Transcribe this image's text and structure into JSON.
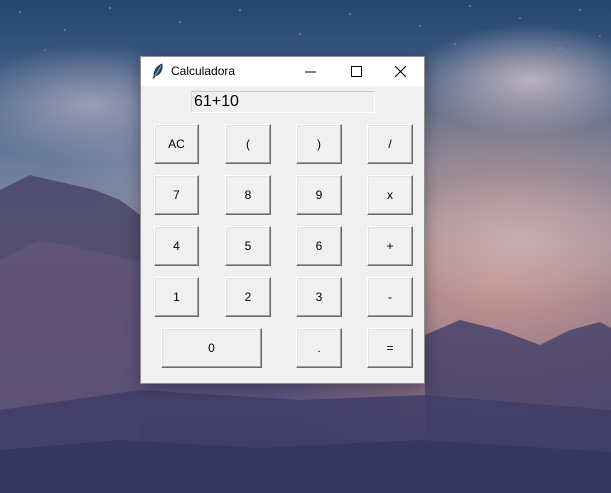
{
  "window": {
    "title": "Calculadora",
    "icon": "feather-icon",
    "controls": {
      "minimize_icon": "minimize-icon",
      "maximize_icon": "maximize-icon",
      "close_icon": "close-icon"
    }
  },
  "display": {
    "value": "61+10"
  },
  "keys": {
    "ac": "AC",
    "open_paren": "(",
    "close_paren": ")",
    "divide": "/",
    "seven": "7",
    "eight": "8",
    "nine": "9",
    "multiply": "x",
    "four": "4",
    "five": "5",
    "six": "6",
    "plus": "+",
    "one": "1",
    "two": "2",
    "three": "3",
    "minus": "-",
    "zero": "0",
    "dot": ".",
    "equals": "="
  },
  "colors": {
    "window_bg": "#f0f0f0",
    "titlebar_bg": "#ffffff"
  }
}
